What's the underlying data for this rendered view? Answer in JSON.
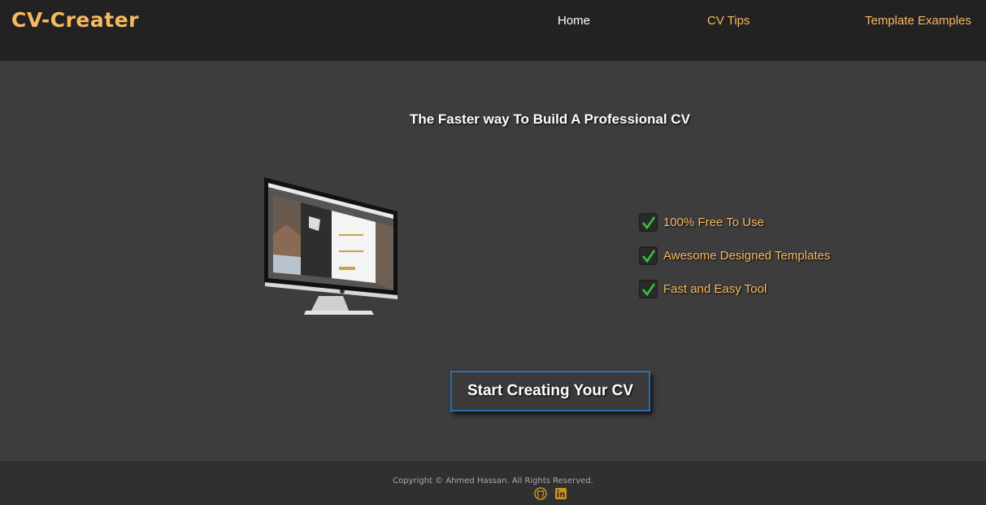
{
  "header": {
    "brand": "CV-Creater",
    "nav": [
      {
        "label": "Home"
      },
      {
        "label": "CV Tips"
      },
      {
        "label": "Template Examples"
      }
    ]
  },
  "hero": {
    "title": "The Faster way To Build A Professional CV",
    "image_icon": "imac-monitor-icon",
    "features": [
      {
        "label": "100% Free To Use"
      },
      {
        "label": "Awesome Designed Templates"
      },
      {
        "label": "Fast and Easy Tool"
      }
    ],
    "cta_label": "Start Creating Your CV"
  },
  "footer": {
    "copyright": "Copyright © Ahmed Hassan. All Rights Reserved.",
    "icons": [
      "github-icon",
      "linkedin-icon"
    ]
  },
  "colors": {
    "accent": "#f6b960",
    "navbar_bg": "#222222",
    "main_bg": "#3d3d3d",
    "footer_bg": "#303030",
    "cta_border": "#2a6fb0",
    "check_green": "#3cc43c"
  }
}
